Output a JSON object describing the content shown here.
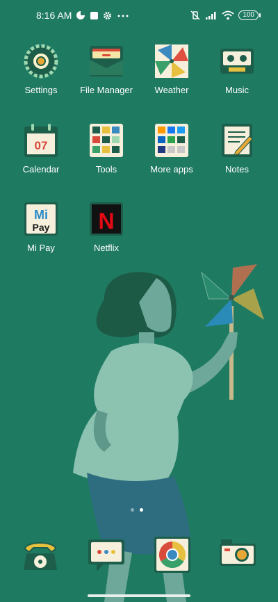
{
  "status_bar": {
    "time": "8:16 AM",
    "battery": "100",
    "notification_icons": [
      "pie-icon",
      "square-icon",
      "gear-icon",
      "more-icon"
    ],
    "system_icons": [
      "vibrate-icon",
      "signal-icon",
      "wifi-icon",
      "battery-icon"
    ]
  },
  "apps": [
    {
      "label": "Settings",
      "icon": "settings-icon"
    },
    {
      "label": "File Manager",
      "icon": "file-manager-icon"
    },
    {
      "label": "Weather",
      "icon": "weather-icon"
    },
    {
      "label": "Music",
      "icon": "music-icon"
    },
    {
      "label": "Calendar",
      "icon": "calendar-icon",
      "date": "07"
    },
    {
      "label": "Tools",
      "icon": "tools-icon"
    },
    {
      "label": "More apps",
      "icon": "more-apps-icon"
    },
    {
      "label": "Notes",
      "icon": "notes-icon"
    },
    {
      "label": "Mi Pay",
      "icon": "mi-pay-icon",
      "text": [
        "Mi",
        "Pay"
      ]
    },
    {
      "label": "Netflix",
      "icon": "netflix-icon",
      "text": "N"
    }
  ],
  "page_indicator": {
    "pages": 2,
    "current": 2
  },
  "dock": [
    "phone-icon",
    "messages-icon",
    "chrome-icon",
    "camera-icon"
  ],
  "colors": {
    "background": "#1f7a62",
    "accent_red": "#d84a3a",
    "netflix_red": "#e50914"
  }
}
